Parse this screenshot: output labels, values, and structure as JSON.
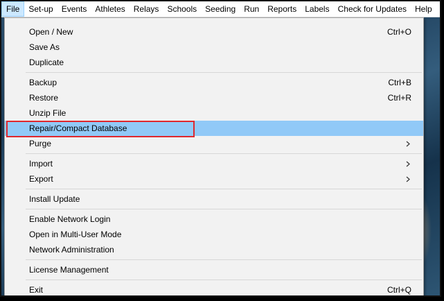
{
  "menubar": [
    {
      "id": "file",
      "label": "File",
      "active": true
    },
    {
      "id": "setup",
      "label": "Set-up"
    },
    {
      "id": "events",
      "label": "Events"
    },
    {
      "id": "athletes",
      "label": "Athletes"
    },
    {
      "id": "relays",
      "label": "Relays"
    },
    {
      "id": "schools",
      "label": "Schools"
    },
    {
      "id": "seeding",
      "label": "Seeding"
    },
    {
      "id": "run",
      "label": "Run"
    },
    {
      "id": "reports",
      "label": "Reports"
    },
    {
      "id": "labels",
      "label": "Labels"
    },
    {
      "id": "check-updates",
      "label": "Check for Updates"
    },
    {
      "id": "help",
      "label": "Help"
    }
  ],
  "file_menu": [
    {
      "label": "Open / New",
      "shortcut": "Ctrl+O"
    },
    {
      "label": "Save As"
    },
    {
      "label": "Duplicate"
    },
    {
      "separator": true
    },
    {
      "label": "Backup",
      "shortcut": "Ctrl+B"
    },
    {
      "label": "Restore",
      "shortcut": "Ctrl+R"
    },
    {
      "label": "Unzip File"
    },
    {
      "label": "Repair/Compact Database",
      "selected": true,
      "highlighted": true
    },
    {
      "label": "Purge",
      "submenu": true
    },
    {
      "separator": true
    },
    {
      "label": "Import",
      "submenu": true
    },
    {
      "label": "Export",
      "submenu": true
    },
    {
      "separator": true
    },
    {
      "label": "Install Update"
    },
    {
      "separator": true
    },
    {
      "label": "Enable Network Login"
    },
    {
      "label": "Open in Multi-User Mode"
    },
    {
      "label": "Network Administration"
    },
    {
      "separator": true
    },
    {
      "label": "License Management"
    },
    {
      "separator": true
    },
    {
      "label": "Exit",
      "shortcut": "Ctrl+Q"
    }
  ],
  "colors": {
    "selected_bg": "#91c9f7",
    "highlight_border": "#e0282e",
    "menu_bg": "#f2f2f2"
  },
  "icons": {
    "submenu": "chevron-right-icon"
  }
}
